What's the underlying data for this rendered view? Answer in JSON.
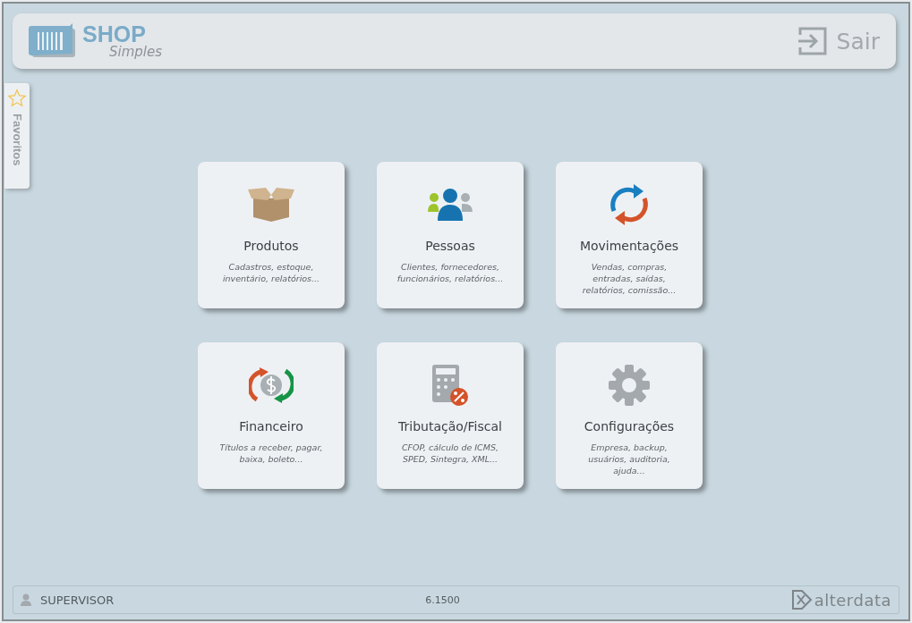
{
  "header": {
    "logo_title": "SHOP",
    "logo_subtitle": "Simples",
    "exit_label": "Sair"
  },
  "favorites": {
    "label": "Favoritos"
  },
  "modules": [
    {
      "kind": "box",
      "title": "Produtos",
      "lines": [
        "Cadastros, estoque,",
        "inventário, relatórios..."
      ]
    },
    {
      "kind": "people",
      "title": "Pessoas",
      "lines": [
        "Clientes, fornecedores,",
        "funcionários, relatórios..."
      ]
    },
    {
      "kind": "sync",
      "title": "Movimentações",
      "lines": [
        "Vendas, compras,",
        "entradas, saídas,",
        "relatórios, comissão..."
      ]
    },
    {
      "kind": "money",
      "title": "Financeiro",
      "lines": [
        "Títulos a receber, pagar,",
        "baixa, boleto..."
      ]
    },
    {
      "kind": "calculator",
      "title": "Tributação/Fiscal",
      "lines": [
        "CFOP, cálculo de ICMS,",
        "SPED, Sintegra, XML..."
      ]
    },
    {
      "kind": "gear",
      "title": "Configurações",
      "lines": [
        "Empresa, backup,",
        "usuários, auditoria,",
        "ajuda..."
      ]
    }
  ],
  "status_bar": {
    "user": "SUPERVISOR",
    "version": "6.1500",
    "brand": "alterdata"
  }
}
